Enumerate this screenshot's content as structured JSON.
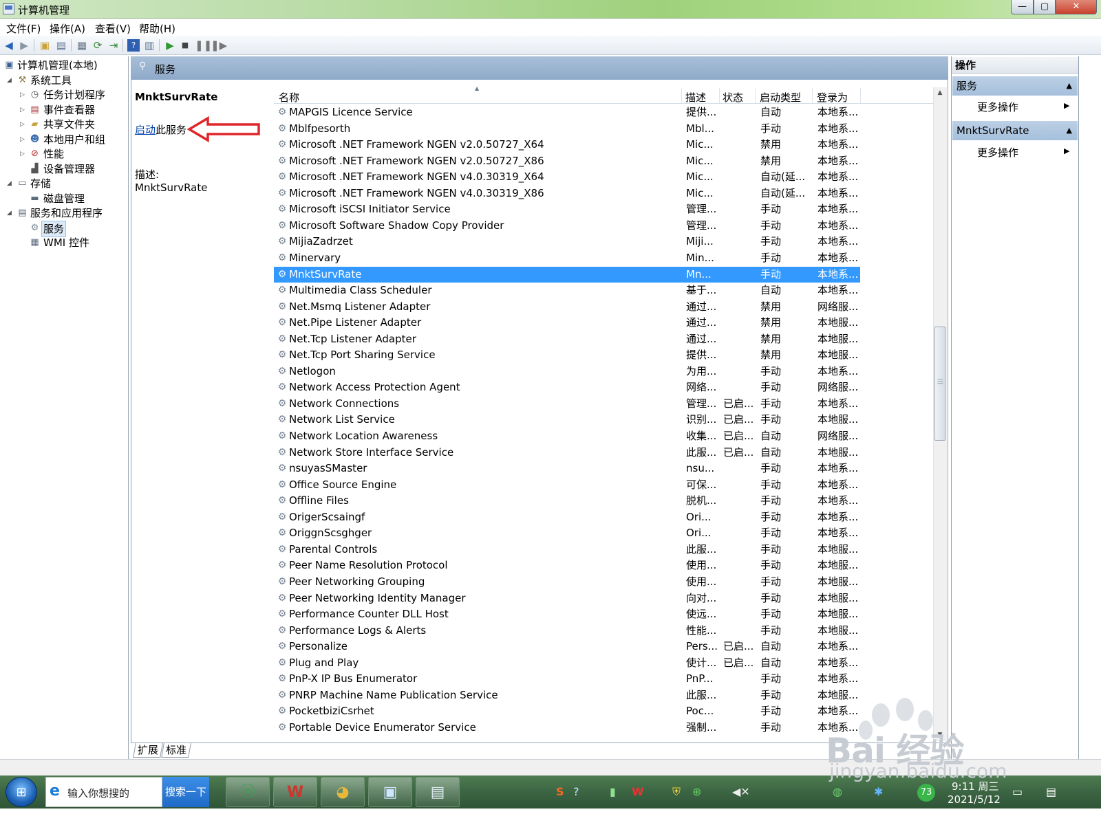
{
  "window": {
    "title": "计算机管理",
    "min": "—",
    "max": "▢",
    "close": "✕"
  },
  "menu": [
    "文件(F)",
    "操作(A)",
    "查看(V)",
    "帮助(H)"
  ],
  "tree": {
    "root": "计算机管理(本地)",
    "system_tools": "系统工具",
    "task_scheduler": "任务计划程序",
    "event_viewer": "事件查看器",
    "shared_folders": "共享文件夹",
    "local_users": "本地用户和组",
    "performance": "性能",
    "device_manager": "设备管理器",
    "storage": "存储",
    "disk_management": "磁盘管理",
    "services_apps": "服务和应用程序",
    "services": "服务",
    "wmi": "WMI 控件"
  },
  "center": {
    "header": "服务",
    "extended": {
      "service_name": "MnktSurvRate",
      "start_link": "启动",
      "start_suffix": "此服务",
      "desc_label": "描述:",
      "desc_value": "MnktSurvRate"
    },
    "columns": {
      "name": "名称",
      "desc": "描述",
      "status": "状态",
      "startup": "启动类型",
      "logon": "登录为"
    },
    "selected_index": 10,
    "rows": [
      {
        "name": "MAPGIS Licence Service",
        "desc": "提供...",
        "status": "",
        "startup": "自动",
        "logon": "本地系..."
      },
      {
        "name": "Mblfpesorth",
        "desc": "Mbl...",
        "status": "",
        "startup": "手动",
        "logon": "本地系..."
      },
      {
        "name": "Microsoft .NET Framework NGEN v2.0.50727_X64",
        "desc": "Mic...",
        "status": "",
        "startup": "禁用",
        "logon": "本地系..."
      },
      {
        "name": "Microsoft .NET Framework NGEN v2.0.50727_X86",
        "desc": "Mic...",
        "status": "",
        "startup": "禁用",
        "logon": "本地系..."
      },
      {
        "name": "Microsoft .NET Framework NGEN v4.0.30319_X64",
        "desc": "Mic...",
        "status": "",
        "startup": "自动(延...",
        "logon": "本地系..."
      },
      {
        "name": "Microsoft .NET Framework NGEN v4.0.30319_X86",
        "desc": "Mic...",
        "status": "",
        "startup": "自动(延...",
        "logon": "本地系..."
      },
      {
        "name": "Microsoft iSCSI Initiator Service",
        "desc": "管理...",
        "status": "",
        "startup": "手动",
        "logon": "本地系..."
      },
      {
        "name": "Microsoft Software Shadow Copy Provider",
        "desc": "管理...",
        "status": "",
        "startup": "手动",
        "logon": "本地系..."
      },
      {
        "name": "MijiaZadrzet",
        "desc": "Miji...",
        "status": "",
        "startup": "手动",
        "logon": "本地系..."
      },
      {
        "name": "Minervary",
        "desc": "Min...",
        "status": "",
        "startup": "手动",
        "logon": "本地系..."
      },
      {
        "name": "MnktSurvRate",
        "desc": "Mn...",
        "status": "",
        "startup": "手动",
        "logon": "本地系..."
      },
      {
        "name": "Multimedia Class Scheduler",
        "desc": "基于...",
        "status": "",
        "startup": "自动",
        "logon": "本地系..."
      },
      {
        "name": "Net.Msmq Listener Adapter",
        "desc": "通过...",
        "status": "",
        "startup": "禁用",
        "logon": "网络服..."
      },
      {
        "name": "Net.Pipe Listener Adapter",
        "desc": "通过...",
        "status": "",
        "startup": "禁用",
        "logon": "本地服..."
      },
      {
        "name": "Net.Tcp Listener Adapter",
        "desc": "通过...",
        "status": "",
        "startup": "禁用",
        "logon": "本地服..."
      },
      {
        "name": "Net.Tcp Port Sharing Service",
        "desc": "提供...",
        "status": "",
        "startup": "禁用",
        "logon": "本地服..."
      },
      {
        "name": "Netlogon",
        "desc": "为用...",
        "status": "",
        "startup": "手动",
        "logon": "本地系..."
      },
      {
        "name": "Network Access Protection Agent",
        "desc": "网络...",
        "status": "",
        "startup": "手动",
        "logon": "网络服..."
      },
      {
        "name": "Network Connections",
        "desc": "管理...",
        "status": "已启...",
        "startup": "手动",
        "logon": "本地系..."
      },
      {
        "name": "Network List Service",
        "desc": "识别...",
        "status": "已启...",
        "startup": "手动",
        "logon": "本地服..."
      },
      {
        "name": "Network Location Awareness",
        "desc": "收集...",
        "status": "已启...",
        "startup": "自动",
        "logon": "网络服..."
      },
      {
        "name": "Network Store Interface Service",
        "desc": "此服...",
        "status": "已启...",
        "startup": "自动",
        "logon": "本地服..."
      },
      {
        "name": "nsuyasSMaster",
        "desc": "nsu...",
        "status": "",
        "startup": "手动",
        "logon": "本地系..."
      },
      {
        "name": "Office Source Engine",
        "desc": "可保...",
        "status": "",
        "startup": "手动",
        "logon": "本地系..."
      },
      {
        "name": "Offline Files",
        "desc": "脱机...",
        "status": "",
        "startup": "手动",
        "logon": "本地系..."
      },
      {
        "name": "OrigerScsaingf",
        "desc": "Ori...",
        "status": "",
        "startup": "手动",
        "logon": "本地系..."
      },
      {
        "name": "OriggnScsghger",
        "desc": "Ori...",
        "status": "",
        "startup": "手动",
        "logon": "本地系..."
      },
      {
        "name": "Parental Controls",
        "desc": "此服...",
        "status": "",
        "startup": "手动",
        "logon": "本地服..."
      },
      {
        "name": "Peer Name Resolution Protocol",
        "desc": "使用...",
        "status": "",
        "startup": "手动",
        "logon": "本地服..."
      },
      {
        "name": "Peer Networking Grouping",
        "desc": "使用...",
        "status": "",
        "startup": "手动",
        "logon": "本地服..."
      },
      {
        "name": "Peer Networking Identity Manager",
        "desc": "向对...",
        "status": "",
        "startup": "手动",
        "logon": "本地服..."
      },
      {
        "name": "Performance Counter DLL Host",
        "desc": "使远...",
        "status": "",
        "startup": "手动",
        "logon": "本地服..."
      },
      {
        "name": "Performance Logs & Alerts",
        "desc": "性能...",
        "status": "",
        "startup": "手动",
        "logon": "本地服..."
      },
      {
        "name": "Personalize",
        "desc": "Pers...",
        "status": "已启...",
        "startup": "自动",
        "logon": "本地系..."
      },
      {
        "name": "Plug and Play",
        "desc": "使计...",
        "status": "已启...",
        "startup": "自动",
        "logon": "本地系..."
      },
      {
        "name": "PnP-X IP Bus Enumerator",
        "desc": "PnP...",
        "status": "",
        "startup": "手动",
        "logon": "本地系..."
      },
      {
        "name": "PNRP Machine Name Publication Service",
        "desc": "此服...",
        "status": "",
        "startup": "手动",
        "logon": "本地服..."
      },
      {
        "name": "PocketbiziCsrhet",
        "desc": "Poc...",
        "status": "",
        "startup": "手动",
        "logon": "本地系..."
      },
      {
        "name": "Portable Device Enumerator Service",
        "desc": "强制...",
        "status": "",
        "startup": "手动",
        "logon": "本地系..."
      }
    ],
    "tabs": [
      "扩展",
      "标准"
    ]
  },
  "actions": {
    "title": "操作",
    "group1": "服务",
    "group1_item": "更多操作",
    "group2": "MnktSurvRate",
    "group2_item": "更多操作"
  },
  "taskbar": {
    "search_placeholder": "输入你想搜的",
    "search_button": "搜索一下",
    "tray_badge": "73",
    "time": "9:11 周三",
    "date": "2021/5/12"
  },
  "watermark": {
    "brand": "Bai 经验",
    "url": "jingyan.baidu.com"
  },
  "colors": {
    "selection": "#3399ff",
    "arrow": "#e0262a",
    "link": "#0645ad"
  }
}
